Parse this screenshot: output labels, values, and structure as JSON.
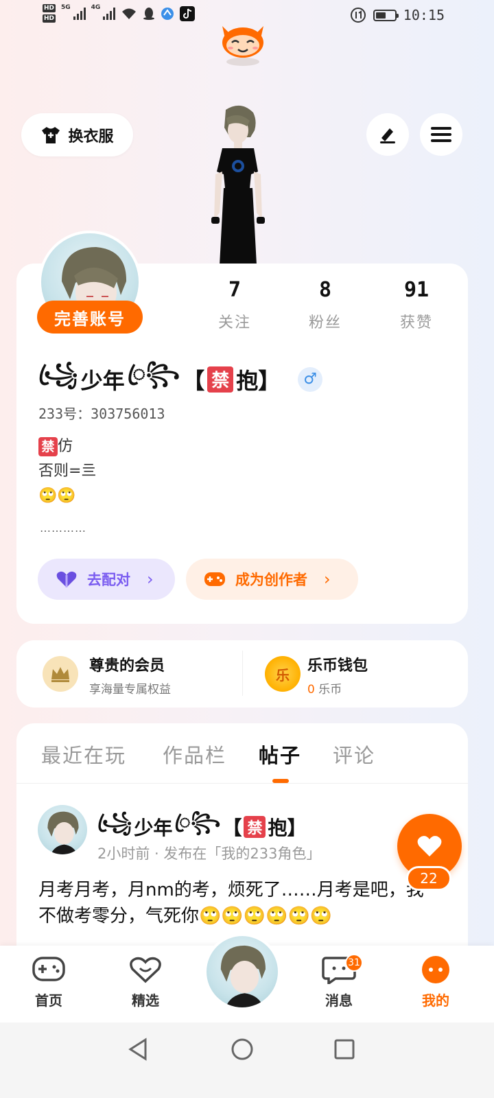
{
  "status_bar": {
    "hd1": "HD",
    "hd2": "HD",
    "net1": "5G",
    "net2": "4G",
    "time": "10:15"
  },
  "top": {
    "outfit_label": "换衣服"
  },
  "profile": {
    "complete_label": "完善账号",
    "stats": [
      {
        "num": "7",
        "label": "关注"
      },
      {
        "num": "8",
        "label": "粉丝"
      },
      {
        "num": "91",
        "label": "获赞"
      }
    ],
    "name_deco_left": "꧁ꦿ",
    "name_center": "少年",
    "name_deco_right": "ꦿ꧂",
    "name_bracket_open": "【",
    "ban_char": "禁",
    "name_hug": "抱】",
    "gender_symbol": "♂",
    "uid": "233号：303756013",
    "bio_line1": "仿",
    "bio_line2": "否则=亖",
    "bio_line3": "🙄🙄",
    "dots": "…………",
    "pair_label": "去配对",
    "creator_label": "成为创作者"
  },
  "member": {
    "vip_title": "尊贵的会员",
    "vip_sub": "享海量专属权益",
    "wallet_title": "乐币钱包",
    "wallet_amount": "0",
    "wallet_unit": " 乐币",
    "coin_char": "乐"
  },
  "tabs": [
    {
      "label": "最近在玩"
    },
    {
      "label": "作品栏"
    },
    {
      "label": "帖子"
    },
    {
      "label": "评论"
    }
  ],
  "post": {
    "meta": "2小时前 · 发布在「我的233角色」",
    "text": "月考月考，月nm的考，烦死了……月考是吧，我不做考零分，气死你🙄🙄🙄🙄🙄🙄",
    "like_count": "22"
  },
  "bottom_nav": {
    "home": "首页",
    "featured": "精选",
    "messages": "消息",
    "mine": "我的",
    "message_badge": "31"
  },
  "colors": {
    "accent": "#ff6a00",
    "pair_bg": "#ebe7fd",
    "pair_fg": "#7a5cf0",
    "creator_bg": "#fff0e6"
  }
}
